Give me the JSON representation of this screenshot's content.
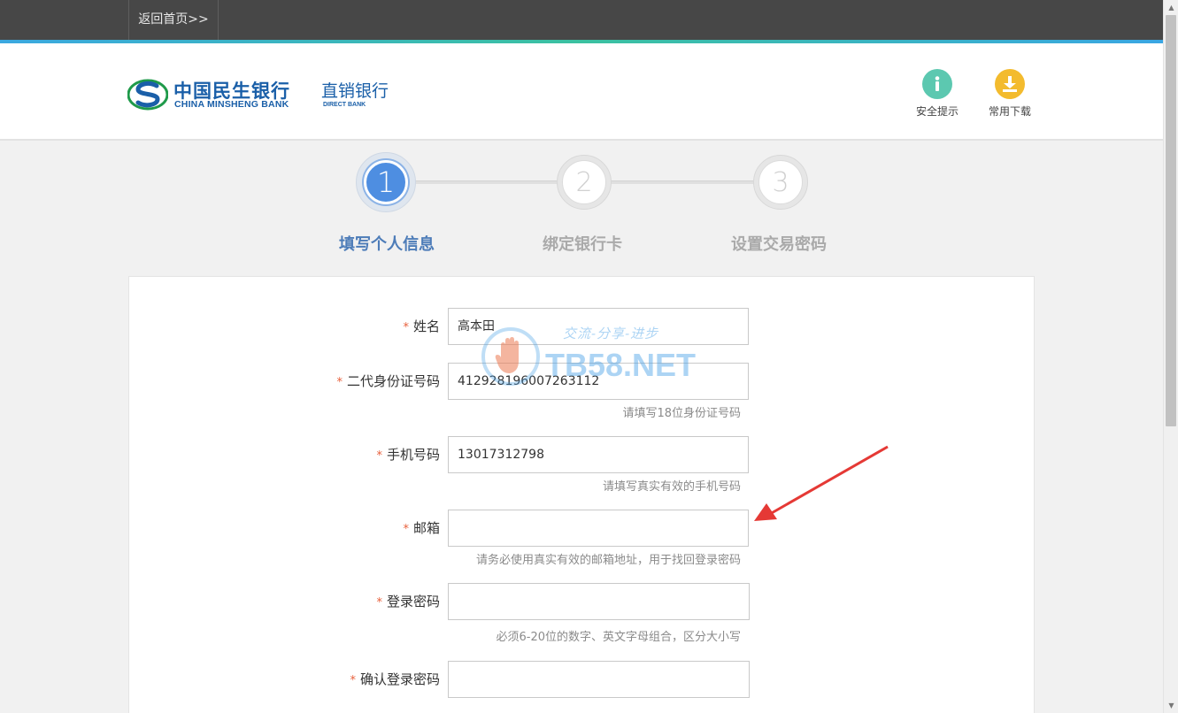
{
  "topbar": {
    "home_link": "返回首页>>"
  },
  "header": {
    "logo": {
      "name_cn": "中国民生银行",
      "name_en": "CHINA MINSHENG BANK",
      "sub_cn": "直销银行",
      "sub_en": "DIRECT BANK",
      "colors": {
        "brand_blue": "#1a5fa8",
        "brand_green": "#1f9a4a"
      }
    },
    "buttons": [
      {
        "label": "安全提示",
        "icon": "info-icon",
        "color": "#5cc8b0"
      },
      {
        "label": "常用下载",
        "icon": "download-icon",
        "color": "#f3bb2e"
      }
    ]
  },
  "steps": [
    {
      "number": "1",
      "label": "填写个人信息",
      "active": true
    },
    {
      "number": "2",
      "label": "绑定银行卡",
      "active": false
    },
    {
      "number": "3",
      "label": "设置交易密码",
      "active": false
    }
  ],
  "form": {
    "required_mark": "*",
    "fields": [
      {
        "label": "姓名",
        "value": "高本田",
        "hint": ""
      },
      {
        "label": "二代身份证号码",
        "value": "412928196007263112",
        "hint": "请填写18位身份证号码"
      },
      {
        "label": "手机号码",
        "value": "13017312798",
        "hint": "请填写真实有效的手机号码"
      },
      {
        "label": "邮箱",
        "value": "",
        "hint": "请务必使用真实有效的邮箱地址，用于找回登录密码"
      },
      {
        "label": "登录密码",
        "value": "",
        "hint": "必须6-20位的数字、英文字母组合，区分大小写"
      },
      {
        "label": "确认登录密码",
        "value": "",
        "hint": ""
      }
    ]
  },
  "watermark": {
    "text": "TB58.NET",
    "slogan": "交流-分享-进步"
  },
  "annotation": {
    "color": "#e53935"
  }
}
